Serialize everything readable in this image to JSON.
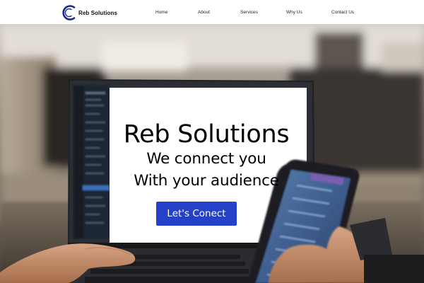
{
  "brand": {
    "name": "Reb Solutions",
    "accent_color": "#2541c8",
    "logo_ring_color": "#1b2a8c"
  },
  "nav": {
    "items": [
      {
        "label": "Home"
      },
      {
        "label": "About"
      },
      {
        "label": "Services"
      },
      {
        "label": "Why Us"
      },
      {
        "label": "Contact Us"
      }
    ]
  },
  "hero": {
    "title": "Reb Solutions",
    "line1": "We connect you",
    "line2": "With your audience",
    "cta_label": "Let's Conect"
  }
}
